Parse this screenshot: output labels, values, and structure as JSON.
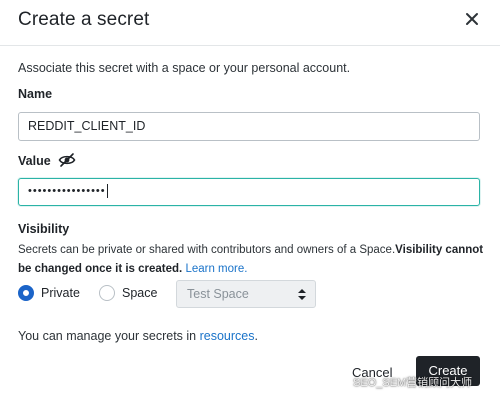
{
  "dialog": {
    "title": "Create a secret",
    "description": "Associate this secret with a space or your personal account."
  },
  "name_field": {
    "label": "Name",
    "value": "REDDIT_CLIENT_ID"
  },
  "value_field": {
    "label": "Value",
    "masked_value": "••••••••••••••••",
    "visibility_toggle_icon": "eye-off-icon"
  },
  "visibility": {
    "label": "Visibility",
    "help_text": "Secrets can be private or shared with contributors and owners of a Space.",
    "help_bold": "Visibility cannot be changed once it is created.",
    "learn_more": "Learn more.",
    "options": [
      "Private",
      "Space"
    ],
    "selected": "Private",
    "space_select_value": "Test Space"
  },
  "footer": {
    "manage_prefix": "You can manage your secrets in ",
    "manage_link": "resources",
    "manage_suffix": ".",
    "cancel_label": "Cancel",
    "create_label": "Create"
  },
  "watermark": {
    "text": "SEO_SEM营销顾问大师"
  },
  "colors": {
    "accent_focus": "#2bb3a6",
    "radio_selected": "#1b64c8",
    "link": "#1a73c9",
    "primary_button": "#1f2328"
  }
}
